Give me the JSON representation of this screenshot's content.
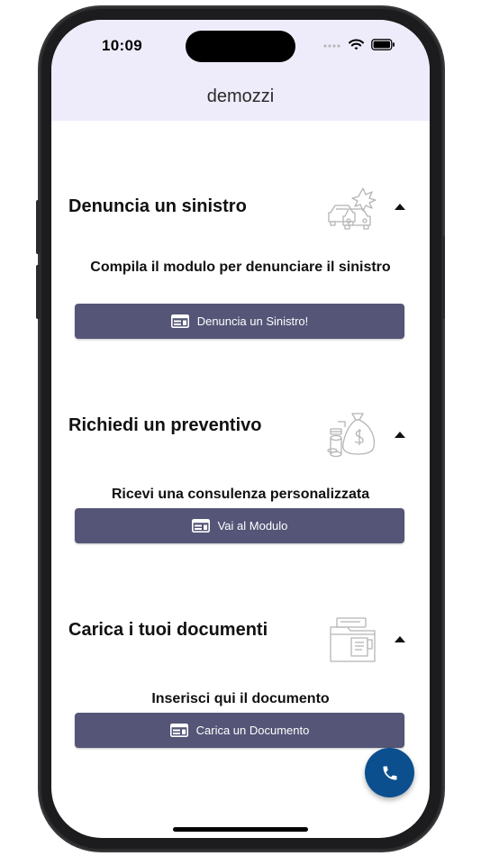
{
  "status_bar": {
    "time": "10:09"
  },
  "app_bar": {
    "title": "demozzi"
  },
  "sections": [
    {
      "title": "Denuncia un sinistro",
      "icon": "car-crash-icon",
      "subtitle": "Compila il modulo per denunciare il sinistro",
      "button_label": "Denuncia un Sinistro!"
    },
    {
      "title": "Richiedi un preventivo",
      "icon": "money-bag-icon",
      "subtitle": "Ricevi una consulenza personalizzata",
      "button_label": "Vai al Modulo"
    },
    {
      "title": "Carica i tuoi documenti",
      "icon": "folder-documents-icon",
      "subtitle": "Inserisci qui il documento",
      "button_label": "Carica un Documento"
    }
  ],
  "fab": {
    "icon": "phone-icon"
  },
  "colors": {
    "header_bg": "#eeecfa",
    "button_bg": "#545577",
    "fab_bg": "#0b4f8e"
  }
}
